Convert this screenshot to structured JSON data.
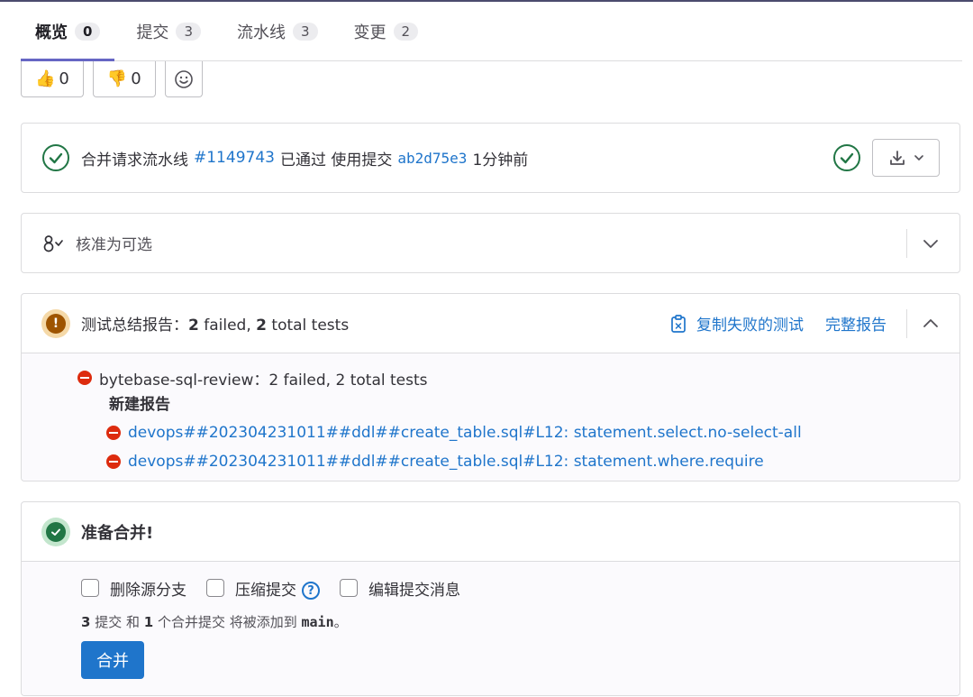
{
  "tabs": [
    {
      "label": "概览",
      "count": "0"
    },
    {
      "label": "提交",
      "count": "3"
    },
    {
      "label": "流水线",
      "count": "3"
    },
    {
      "label": "变更",
      "count": "2"
    }
  ],
  "reactions": {
    "thumbs_up": "0",
    "thumbs_down": "0"
  },
  "pipeline": {
    "prefix": "合并请求流水线",
    "id": "#1149743",
    "status_text": "已通过 使用提交",
    "commit": "ab2d75e3",
    "time": "1分钟前"
  },
  "approval": {
    "text": "核准为可选"
  },
  "tests": {
    "title_prefix": "测试总结报告：",
    "failed_num": "2",
    "failed_label": " failed, ",
    "total_num": "2",
    "total_label": " total tests",
    "copy_failed": "复制失败的测试",
    "full_report": "完整报告",
    "suite_text": "bytebase-sql-review：2 failed, 2 total tests",
    "new_report": "新建报告",
    "cases": [
      "devops##202304231011##ddl##create_table.sql#L12: statement.select.no-select-all",
      "devops##202304231011##ddl##create_table.sql#L12: statement.where.require"
    ]
  },
  "merge": {
    "title": "准备合并!",
    "options": [
      "删除源分支",
      "压缩提交",
      "编辑提交消息"
    ],
    "help": "?",
    "summary": {
      "commits_num": "3",
      "commits_label": " 提交 和 ",
      "merge_num": "1",
      "merge_label": " 个合并提交 将被添加到 ",
      "branch": "main",
      "end": "。"
    },
    "button": "合并"
  },
  "colors": {
    "accent": "#1f75cb",
    "success": "#217645",
    "danger": "#dd2b0e",
    "warning": "#9e5400"
  }
}
